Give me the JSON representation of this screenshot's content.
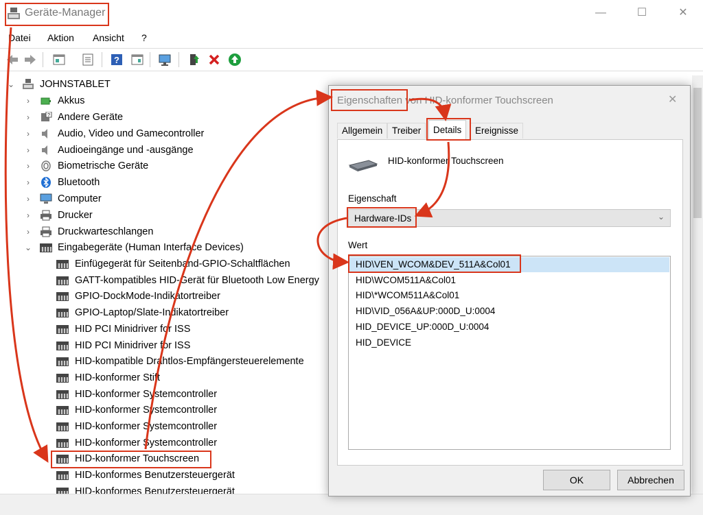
{
  "window": {
    "title": "Geräte-Manager",
    "minimize_glyph": "—",
    "maximize_glyph": "☐",
    "close_glyph": "✕"
  },
  "menu": [
    "Datei",
    "Aktion",
    "Ansicht",
    "?"
  ],
  "toolbar": {
    "icons": [
      "back-arrow-icon",
      "forward-arrow-icon",
      "properties-view-icon",
      "list-view-icon",
      "help-icon",
      "details-view-icon",
      "monitor-scan-icon",
      "update-driver-icon",
      "uninstall-icon",
      "enable-device-icon"
    ]
  },
  "tree": {
    "root": "JOHNSTABLET",
    "categories": [
      {
        "label": "Akkus",
        "icon": "battery-icon"
      },
      {
        "label": "Andere Geräte",
        "icon": "unknown-device-icon"
      },
      {
        "label": "Audio, Video und Gamecontroller",
        "icon": "speaker-icon"
      },
      {
        "label": "Audioeingänge und -ausgänge",
        "icon": "speaker-icon"
      },
      {
        "label": "Biometrische Geräte",
        "icon": "fingerprint-icon"
      },
      {
        "label": "Bluetooth",
        "icon": "bluetooth-icon"
      },
      {
        "label": "Computer",
        "icon": "computer-icon"
      },
      {
        "label": "Drucker",
        "icon": "printer-icon"
      },
      {
        "label": "Druckwarteschlangen",
        "icon": "printer-icon"
      }
    ],
    "expanded": {
      "label": "Eingabegeräte (Human Interface Devices)",
      "children": [
        "Einfügegerät für Seitenband-GPIO-Schaltflächen",
        "GATT-kompatibles HID-Gerät für Bluetooth Low Energy",
        "GPIO-DockMode-Indikatortreiber",
        "GPIO-Laptop/Slate-Indikatortreiber",
        "HID PCI Minidriver for ISS",
        "HID PCI Minidriver for ISS",
        "HID-kompatible Drahtlos-Empfängersteuerelemente",
        "HID-konformer Stift",
        "HID-konformer Systemcontroller",
        "HID-konformer Systemcontroller",
        "HID-konformer Systemcontroller",
        "HID-konformer Systemcontroller",
        "HID-konformer Touchscreen",
        "HID-konformes Benutzersteuergerät",
        "HID-konformes Benutzersteuergerät"
      ]
    }
  },
  "dialog": {
    "title": "Eigenschaften von HID-konformer Touchscreen",
    "close_glyph": "✕",
    "tabs": [
      "Allgemein",
      "Treiber",
      "Details",
      "Ereignisse"
    ],
    "active_tab": "Details",
    "device_name": "HID-konformer Touchscreen",
    "property_label": "Eigenschaft",
    "property_value": "Hardware-IDs",
    "value_label": "Wert",
    "values": [
      "HID\\VEN_WCOM&DEV_511A&Col01",
      "HID\\WCOM511A&Col01",
      "HID\\*WCOM511A&Col01",
      "HID\\VID_056A&UP:000D_U:0004",
      "HID_DEVICE_UP:000D_U:0004",
      "HID_DEVICE"
    ],
    "ok_label": "OK",
    "cancel_label": "Abbrechen"
  },
  "colors": {
    "highlight": "#d9361b",
    "selection": "#cce4f7"
  }
}
